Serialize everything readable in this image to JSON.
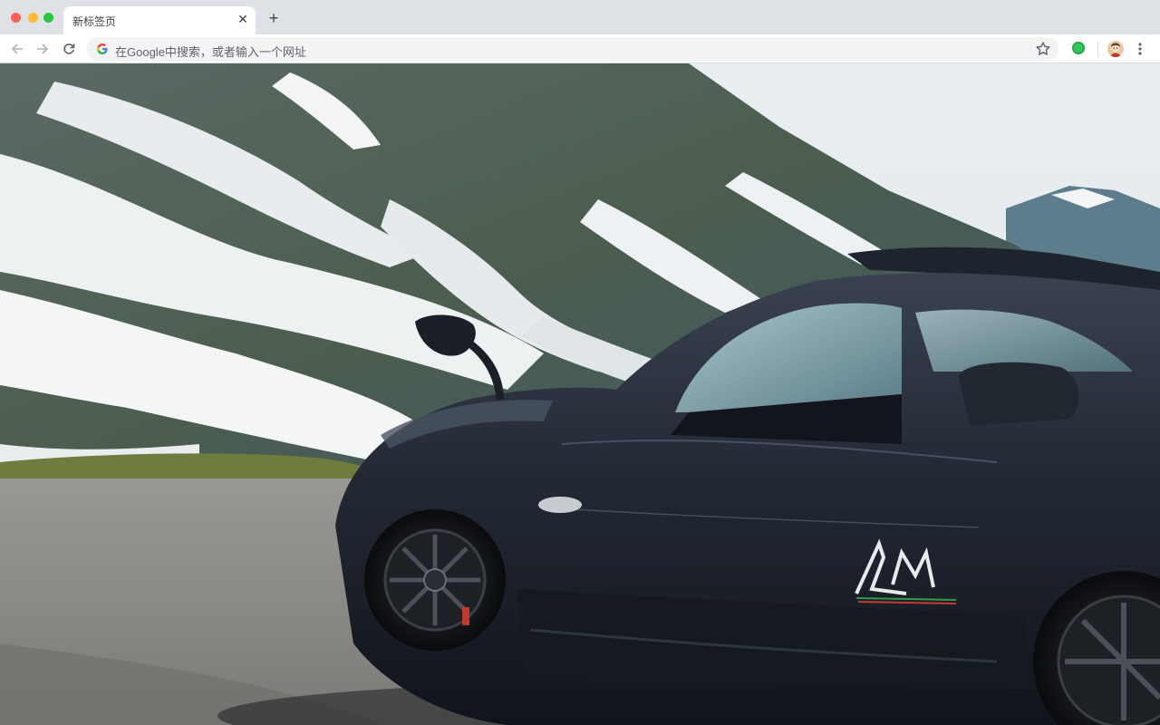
{
  "window": {
    "tab_title": "新标签页"
  },
  "toolbar": {
    "omnibox_placeholder": "在Google中搜索，或者输入一个网址"
  },
  "icons": {
    "back": "arrow-left-icon",
    "forward": "arrow-right-icon",
    "reload": "reload-icon",
    "google": "google-g-icon",
    "bookmark": "star-icon",
    "extension": "green-circle-icon",
    "profile": "avatar",
    "menu": "kebab-menu-icon"
  },
  "colors": {
    "tabstrip": "#dee1e6",
    "omnibox": "#f1f3f4",
    "car_body": "#1c2028",
    "sky": "#e6ecef"
  }
}
